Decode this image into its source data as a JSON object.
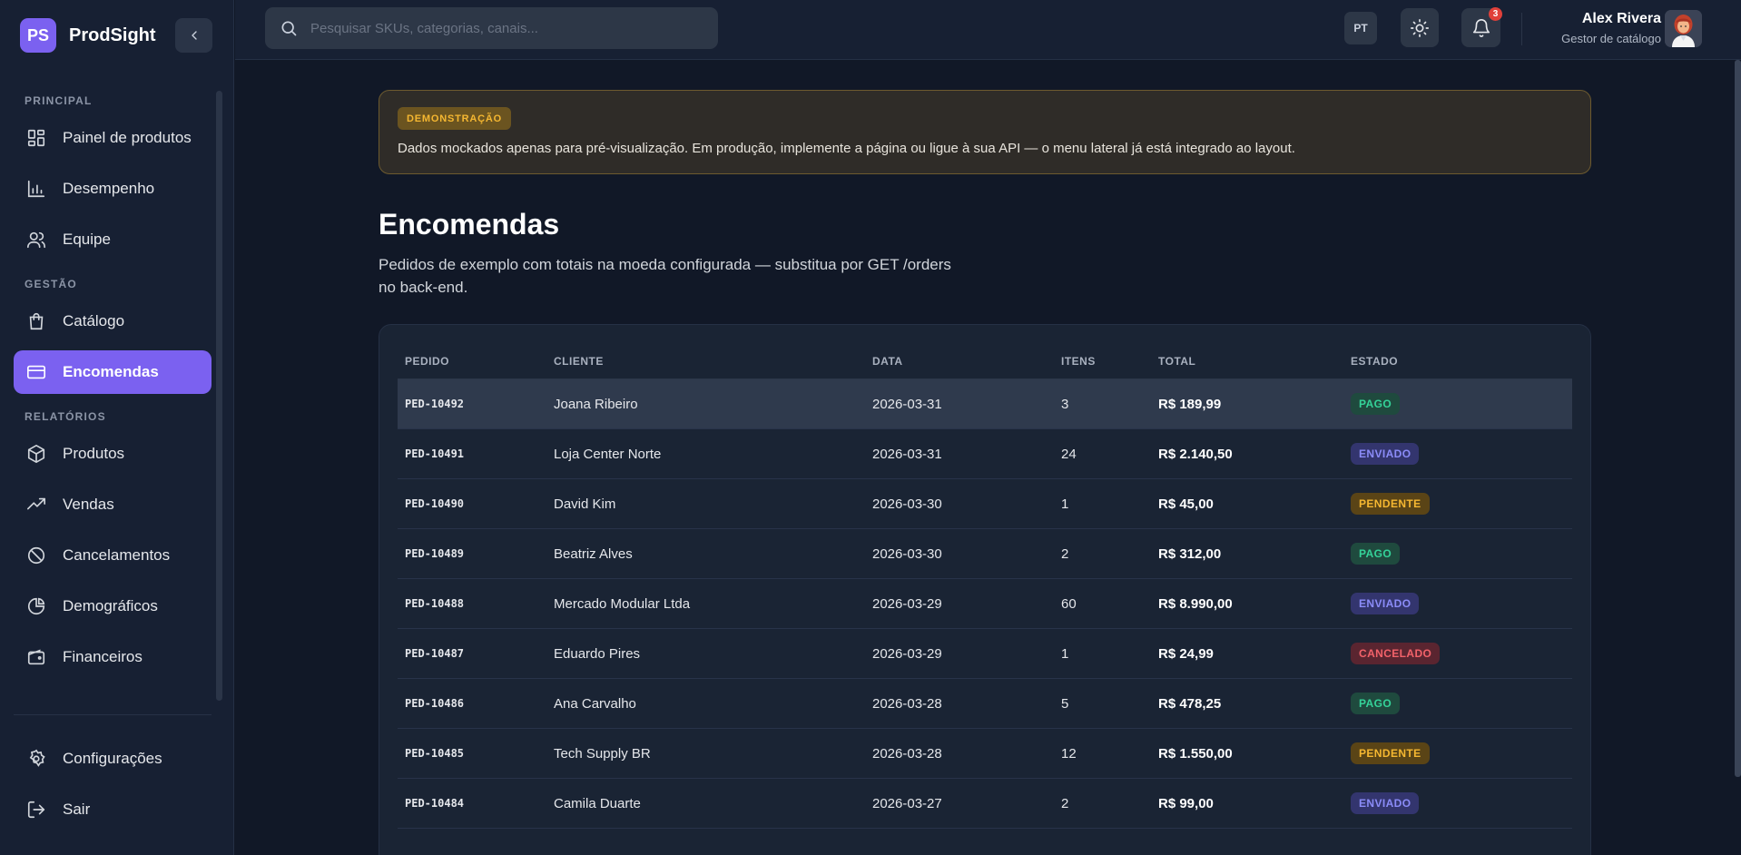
{
  "brand": {
    "logo": "PS",
    "name": "ProdSight"
  },
  "sidebar": {
    "sections": [
      {
        "title": "PRINCIPAL",
        "items": [
          {
            "label": "Painel de produtos",
            "icon": "dashboard-icon"
          },
          {
            "label": "Desempenho",
            "icon": "bar-chart-icon"
          },
          {
            "label": "Equipe",
            "icon": "users-icon"
          }
        ]
      },
      {
        "title": "GESTÃO",
        "items": [
          {
            "label": "Catálogo",
            "icon": "shopping-bag-icon"
          },
          {
            "label": "Encomendas",
            "icon": "credit-card-icon",
            "active": true
          }
        ]
      },
      {
        "title": "RELATÓRIOS",
        "items": [
          {
            "label": "Produtos",
            "icon": "box-icon"
          },
          {
            "label": "Vendas",
            "icon": "trending-up-icon"
          },
          {
            "label": "Cancelamentos",
            "icon": "ban-icon"
          },
          {
            "label": "Demográficos",
            "icon": "pie-chart-icon"
          },
          {
            "label": "Financeiros",
            "icon": "wallet-icon"
          }
        ]
      }
    ],
    "bottom": [
      {
        "label": "Configurações",
        "icon": "gear-icon"
      },
      {
        "label": "Sair",
        "icon": "logout-icon"
      }
    ]
  },
  "topbar": {
    "search_placeholder": "Pesquisar SKUs, categorias, canais...",
    "lang": "PT",
    "notifications": "3",
    "user_name": "Alex Rivera",
    "user_role": "Gestor de catálogo"
  },
  "demo": {
    "tag": "DEMONSTRAÇÃO",
    "text": "Dados mockados apenas para pré-visualização. Em produção, implemente a página ou ligue à sua API — o menu lateral já está integrado ao layout."
  },
  "page": {
    "title": "Encomendas",
    "subtitle": "Pedidos de exemplo com totais na moeda configurada — substitua por GET /orders no back-end."
  },
  "table": {
    "columns": [
      "PEDIDO",
      "CLIENTE",
      "DATA",
      "ITENS",
      "TOTAL",
      "ESTADO"
    ],
    "rows": [
      {
        "id": "PED-10492",
        "client": "Joana Ribeiro",
        "date": "2026-03-31",
        "items": "3",
        "total": "R$ 189,99",
        "status": "PAGO"
      },
      {
        "id": "PED-10491",
        "client": "Loja Center Norte",
        "date": "2026-03-31",
        "items": "24",
        "total": "R$ 2.140,50",
        "status": "ENVIADO"
      },
      {
        "id": "PED-10490",
        "client": "David Kim",
        "date": "2026-03-30",
        "items": "1",
        "total": "R$ 45,00",
        "status": "PENDENTE"
      },
      {
        "id": "PED-10489",
        "client": "Beatriz Alves",
        "date": "2026-03-30",
        "items": "2",
        "total": "R$ 312,00",
        "status": "PAGO"
      },
      {
        "id": "PED-10488",
        "client": "Mercado Modular Ltda",
        "date": "2026-03-29",
        "items": "60",
        "total": "R$ 8.990,00",
        "status": "ENVIADO"
      },
      {
        "id": "PED-10487",
        "client": "Eduardo Pires",
        "date": "2026-03-29",
        "items": "1",
        "total": "R$ 24,99",
        "status": "CANCELADO"
      },
      {
        "id": "PED-10486",
        "client": "Ana Carvalho",
        "date": "2026-03-28",
        "items": "5",
        "total": "R$ 478,25",
        "status": "PAGO"
      },
      {
        "id": "PED-10485",
        "client": "Tech Supply BR",
        "date": "2026-03-28",
        "items": "12",
        "total": "R$ 1.550,00",
        "status": "PENDENTE"
      },
      {
        "id": "PED-10484",
        "client": "Camila Duarte",
        "date": "2026-03-27",
        "items": "2",
        "total": "R$ 99,00",
        "status": "ENVIADO"
      }
    ]
  }
}
